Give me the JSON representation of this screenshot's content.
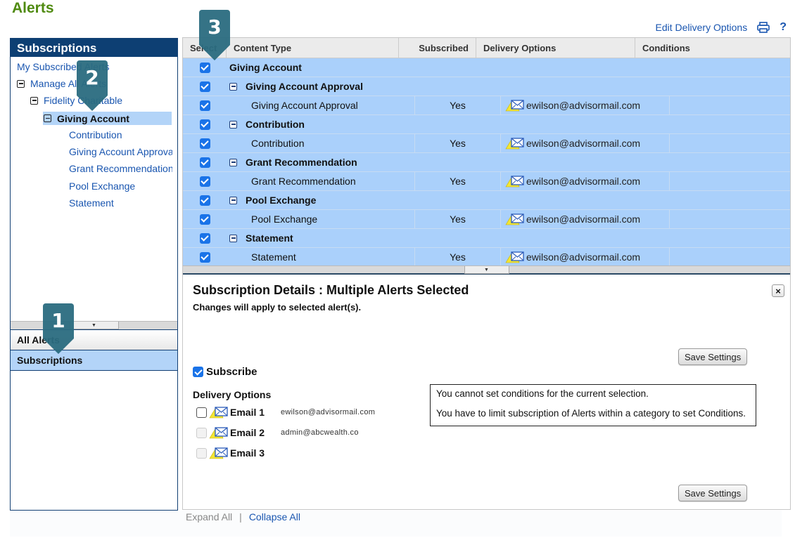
{
  "page": {
    "title": "Alerts"
  },
  "top_links": {
    "edit_delivery": "Edit Delivery Options",
    "print_icon": "printer-icon",
    "help_icon": "help-icon",
    "help_label": "?"
  },
  "sidebar": {
    "header": "Subscriptions",
    "tree": [
      {
        "label": "My Subscribed Alerts",
        "level": 0,
        "icon": ""
      },
      {
        "label": "Manage All Alerts",
        "level": 0,
        "icon": "collapse-icon"
      },
      {
        "label": "Fidelity Charitable",
        "level": 1,
        "icon": "collapse-icon"
      },
      {
        "label": "Giving Account",
        "level": 2,
        "icon": "collapse-icon",
        "selected": true
      },
      {
        "label": "Contribution",
        "level": 3
      },
      {
        "label": "Giving Account Approva",
        "level": 3
      },
      {
        "label": "Grant Recommendation",
        "level": 3
      },
      {
        "label": "Pool Exchange",
        "level": 3
      },
      {
        "label": "Statement",
        "level": 3
      }
    ],
    "accordion": [
      {
        "label": "All Alerts",
        "active": false
      },
      {
        "label": "Subscriptions",
        "active": true
      }
    ]
  },
  "grid": {
    "columns": [
      "Select",
      "Content Type",
      "Subscribed",
      "Delivery Options",
      "Conditions"
    ],
    "rows": [
      {
        "type": "top",
        "checked": true,
        "content": "Giving Account"
      },
      {
        "type": "group",
        "checked": true,
        "content": "Giving Account Approval"
      },
      {
        "type": "leaf",
        "checked": true,
        "content": "Giving Account Approval",
        "subscribed": "Yes",
        "delivery": "ewilson@advisormail.com"
      },
      {
        "type": "group",
        "checked": true,
        "content": "Contribution"
      },
      {
        "type": "leaf",
        "checked": true,
        "content": "Contribution",
        "subscribed": "Yes",
        "delivery": "ewilson@advisormail.com"
      },
      {
        "type": "group",
        "checked": true,
        "content": "Grant Recommendation"
      },
      {
        "type": "leaf",
        "checked": true,
        "content": "Grant Recommendation",
        "subscribed": "Yes",
        "delivery": "ewilson@advisormail.com"
      },
      {
        "type": "group",
        "checked": true,
        "content": "Pool Exchange"
      },
      {
        "type": "leaf",
        "checked": true,
        "content": "Pool Exchange",
        "subscribed": "Yes",
        "delivery": "ewilson@advisormail.com"
      },
      {
        "type": "group",
        "checked": true,
        "content": "Statement"
      },
      {
        "type": "leaf",
        "checked": true,
        "content": "Statement",
        "subscribed": "Yes",
        "delivery": "ewilson@advisormail.com"
      }
    ]
  },
  "details": {
    "title": "Subscription Details : Multiple Alerts Selected",
    "subtitle": "Changes will apply to selected alert(s).",
    "close_label": "×",
    "save_label": "Save Settings",
    "subscribe_label": "Subscribe",
    "subscribe_checked": true,
    "delivery_label": "Delivery Options",
    "emails": [
      {
        "name": "Email 1",
        "address": "ewilson@advisormail.com",
        "checked": false,
        "enabled": true
      },
      {
        "name": "Email 2",
        "address": "admin@abcwealth.co",
        "checked": false,
        "enabled": false
      },
      {
        "name": "Email 3",
        "address": "",
        "checked": false,
        "enabled": false
      }
    ],
    "conditions_msg_1": "You cannot set conditions for the current selection.",
    "conditions_msg_2": "You have to limit subscription of Alerts within a category to set Conditions."
  },
  "footer": {
    "expand_all": "Expand All",
    "separator": "|",
    "collapse_all": "Collapse All"
  },
  "markers": [
    "1",
    "2",
    "3"
  ]
}
